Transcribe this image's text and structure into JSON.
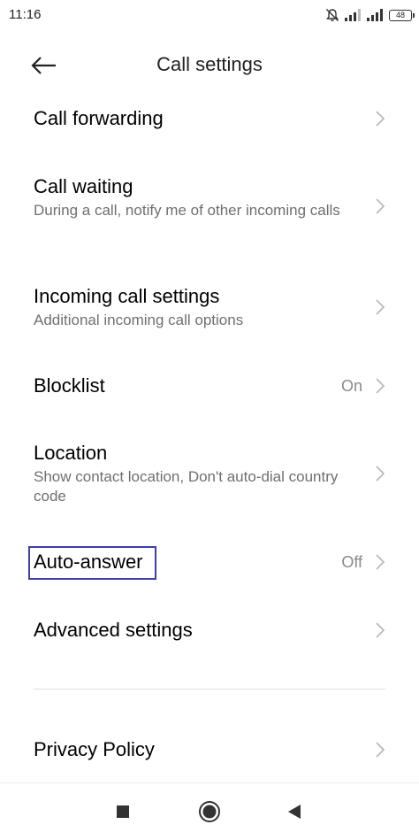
{
  "status_bar": {
    "time": "11:16",
    "battery": "48",
    "icons": [
      "bell-off-icon",
      "signal-icon",
      "signal-icon",
      "battery-icon"
    ]
  },
  "header": {
    "title": "Call settings",
    "back_icon": "arrow-left-icon"
  },
  "settings": {
    "call_forwarding": {
      "title": "Call forwarding"
    },
    "call_waiting": {
      "title": "Call waiting",
      "subtitle": "During a call, notify me of other incoming calls"
    },
    "incoming_call": {
      "title": "Incoming call settings",
      "subtitle": "Additional incoming call options"
    },
    "blocklist": {
      "title": "Blocklist",
      "value": "On"
    },
    "location": {
      "title": "Location",
      "subtitle": "Show contact location, Don't auto-dial country code"
    },
    "auto_answer": {
      "title": "Auto-answer",
      "value": "Off"
    },
    "advanced": {
      "title": "Advanced settings"
    },
    "privacy": {
      "title": "Privacy Policy"
    }
  },
  "nav": {
    "icons": [
      "recents-square-icon",
      "home-circle-icon",
      "back-triangle-icon"
    ]
  },
  "colors": {
    "title_text": "#000000",
    "subtitle_text": "#6f6f6f",
    "value_text": "#8a8a8a",
    "highlight_border": "#3b3fa8"
  }
}
